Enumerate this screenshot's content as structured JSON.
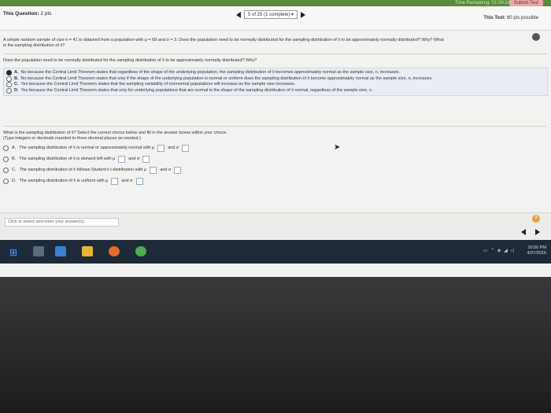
{
  "topbar": {
    "timer": "Time Remaining: 01:09:14",
    "submit": "Submit Test"
  },
  "header": {
    "question_label": "This Question:",
    "question_points": "2 pts",
    "progress": "5 of 25 (1 complete)",
    "dropdown_icon": "triangle-down",
    "test_label": "This Test:",
    "test_points": "60 pts possible"
  },
  "prompt": {
    "line1": "A simple random sample of size n = 41 is obtained from a population with μ = 68 and σ = 3. Does the population need to be normally distributed for the sampling distribution of x̄ to be approximately normally distributed? Why? What",
    "line2": "is the sampling distribution of x̄?"
  },
  "question1": {
    "text": "Does the population need to be normally distributed for the sampling distribution of x̄ to be approximately normally distributed? Why?",
    "options": [
      {
        "letter": "A.",
        "text": "No because the Central Limit Theorem states that regardless of the shape of the underlying population, the sampling distribution of x̄ becomes approximately normal as the sample size, n, increases.",
        "selected": true
      },
      {
        "letter": "B.",
        "text": "No because the Central Limit Theorem states that only if the shape of the underlying population is normal or uniform does the sampling distribution of x̄ become approximately normal as the sample size, n, increases.",
        "selected": false
      },
      {
        "letter": "C.",
        "text": "Yes because the Central Limit Theorem states that the sampling variability of nonnormal populations will increase as the sample size increases.",
        "selected": false
      },
      {
        "letter": "D.",
        "text": "Yes because the Central Limit Theorem states that only for underlying populations that are normal is the shape of the sampling distribution of x̄ normal, regardless of the sample size, n.",
        "selected": false
      }
    ]
  },
  "question2": {
    "text": "What is the sampling distribution of x̄? Select the correct choice below and fill in the answer boxes within your choice.",
    "note": "(Type integers or decimals rounded to three decimal places as needed.)",
    "options": [
      {
        "letter": "A.",
        "pre": "The sampling distribution of x̄ is normal or approximately normal with μ",
        "mid": "and σ"
      },
      {
        "letter": "B.",
        "pre": "The sampling distribution of x̄ is skewed left with μ",
        "mid": "and σ"
      },
      {
        "letter": "C.",
        "pre": "The sampling distribution of x̄ follows Student's t-distribution with μ",
        "mid": "and σ"
      },
      {
        "letter": "D.",
        "pre": "The sampling distribution of x̄ is uniform with μ",
        "mid": "and σ"
      }
    ]
  },
  "footer": {
    "hint": "Click to select and enter your answer(s).",
    "help": "?"
  },
  "taskbar": {
    "time": "10:50 PM",
    "date": "4/27/2016"
  }
}
